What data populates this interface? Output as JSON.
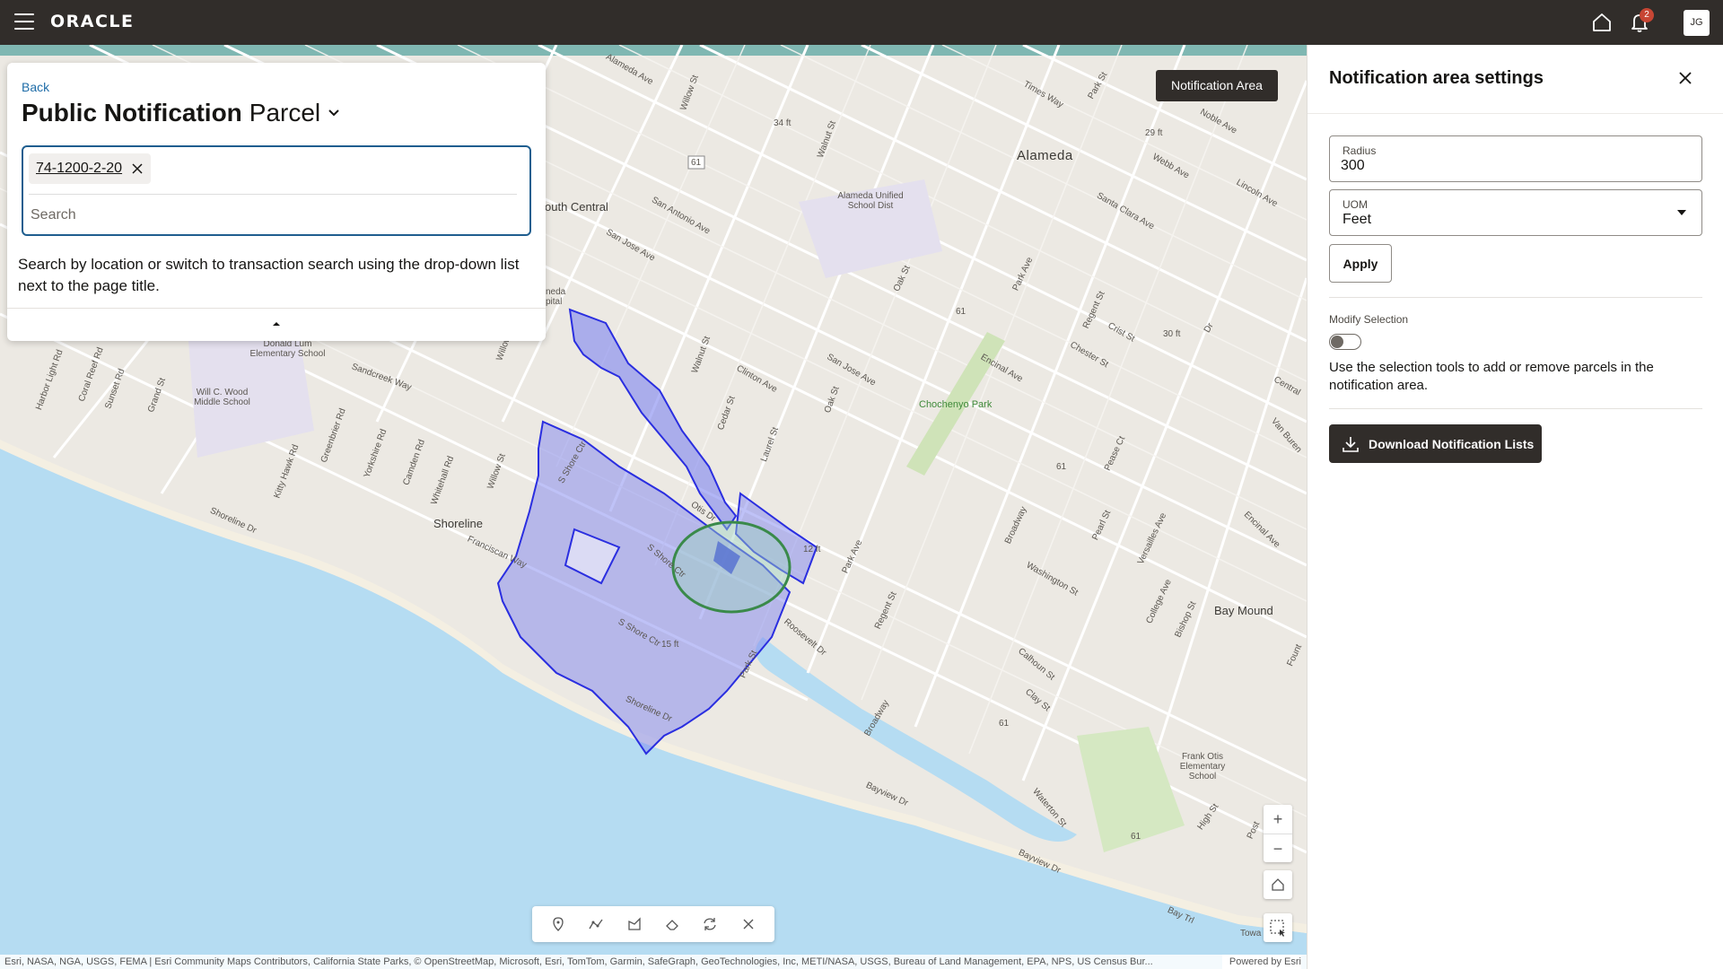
{
  "header": {
    "logo": "ORACLE",
    "notification_count": "2",
    "avatar_initials": "JG"
  },
  "map": {
    "notification_area_button": "Notification Area",
    "labels": {
      "alameda": "Alameda",
      "shoreline": "Shoreline",
      "bay_mound": "Bay Mound",
      "south_central": "outh Central",
      "alameda_usd": "Alameda Unified School Dist",
      "donald_lum": "Donald Lum Elementary School",
      "will_wood": "Will C. Wood Middle School",
      "frank_otis": "Frank Otis Elementary School",
      "chochenyo": "Chochenyo Park",
      "neda_hospital": "neda pital",
      "towa": "Towa",
      "elev_34": "34 ft",
      "elev_29": "29 ft",
      "elev_30": "30 ft",
      "elev_15": "15 ft",
      "elev_12": "12 ft",
      "route_61": "61",
      "st_alameda_ave": "Alameda Ave",
      "st_willow": "Willow St",
      "st_walnut": "Walnut St",
      "st_san_antonio": "San Antonio Ave",
      "st_san_jose": "San Jose Ave",
      "st_times_way": "Times Way",
      "st_park": "Park St",
      "st_webb": "Webb Ave",
      "st_noble": "Noble Ave",
      "st_lincoln": "Lincoln Ave",
      "st_santa_clara": "Santa Clara Ave",
      "st_oak": "Oak St",
      "st_regent": "Regent St",
      "st_crist": "Crist St",
      "st_clinton": "Clinton Ave",
      "st_encinal": "Encinal Ave",
      "st_chester": "Chester St",
      "st_central": "Central",
      "st_van_buren": "Van Buren",
      "st_sandcreek": "Sandcreek Way",
      "st_harbor_light": "Harbor Light Rd",
      "st_coral_reef": "Coral Reef Rd",
      "st_sunset": "Sunset Rd",
      "st_grand": "Grand St",
      "st_kitty_hawk": "Kitty Hawk Rd",
      "st_greenbrier": "Greenbrier Rd",
      "st_yorkshire": "Yorkshire Rd",
      "st_camden": "Camden Rd",
      "st_whitehall": "Whitehall Rd",
      "st_shoreline_dr": "Shoreline Dr",
      "st_franciscan": "Franciscan Way",
      "st_s_shore_ctr": "S Shore Ctr",
      "st_otis": "Otis Dr",
      "st_cedar": "Cedar St",
      "st_laurel": "Laurel St",
      "st_park_ave": "Park Ave",
      "st_broadway": "Broadway",
      "st_washington": "Washington St",
      "st_pearl": "Pearl St",
      "st_versailles": "Versailles Ave",
      "st_college": "College Ave",
      "st_bishop": "Bishop St",
      "st_pease": "Pease Ct",
      "st_calhoun": "Calhoun St",
      "st_clay": "Clay St",
      "st_roosevelt": "Roosevelt Dr",
      "st_bayview": "Bayview Dr",
      "st_waterton": "Waterton St",
      "st_high": "High St",
      "st_bay_trl": "Bay Trl",
      "st_post": "Post",
      "st_fount": "Fount",
      "st_dr": "Dr"
    },
    "attribution": "Esri, NASA, NGA, USGS, FEMA | Esri Community Maps Contributors, California State Parks, © OpenStreetMap, Microsoft, Esri, TomTom, Garmin, SafeGraph, GeoTechnologies, Inc, METI/NASA, USGS, Bureau of Land Management, EPA, NPS, US Census Bur...",
    "powered_by": "Powered by Esri",
    "zoom_in": "+",
    "zoom_out": "−",
    "tool_icons": [
      "point-icon",
      "polyline-icon",
      "polygon-icon",
      "eraser-icon",
      "refresh-icon",
      "clear-icon"
    ]
  },
  "search_panel": {
    "back_label": "Back",
    "title": "Public Notification",
    "subtitle": "Parcel",
    "chip": "74-1200-2-20",
    "search_placeholder": "Search",
    "help_text": "Search by location or switch to transaction search using the drop-down list next to the page title."
  },
  "settings_panel": {
    "title": "Notification area settings",
    "radius_label": "Radius",
    "radius_value": "300",
    "uom_label": "UOM",
    "uom_value": "Feet",
    "apply_label": "Apply",
    "modify_label": "Modify Selection",
    "modify_on": false,
    "modify_help": "Use the selection tools to add or remove parcels in the notification area.",
    "download_label": "Download Notification Lists"
  },
  "colors": {
    "header_bg": "#312d2a",
    "accent_link": "#1f6da8",
    "parcel_fill": "#7f86f0",
    "parcel_stroke": "#2a2ee0",
    "buffer_stroke": "#3a8a4a",
    "water": "#b5dcf2",
    "badge": "#c74634"
  }
}
